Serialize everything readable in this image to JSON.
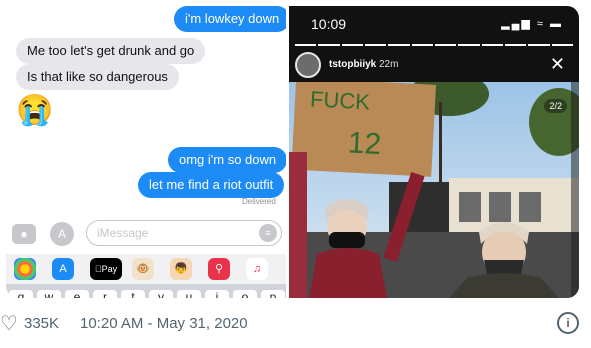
{
  "imessage": {
    "messages": [
      {
        "from": "out",
        "text": "i'm lowkey down"
      },
      {
        "from": "in",
        "text": "Me too let's get drunk and go"
      },
      {
        "from": "in",
        "text": "Is that like so dangerous"
      },
      {
        "from": "in-emoji",
        "text": "😭"
      },
      {
        "from": "out",
        "text": "omg i'm so down"
      },
      {
        "from": "out",
        "text": "let me find a riot outfit"
      }
    ],
    "delivered": "Delivered",
    "input_placeholder": "iMessage",
    "app_icons": [
      "photos-app-icon",
      "app-store-icon",
      "apple-pay-icon",
      "animoji-monkey-icon",
      "memoji-icon",
      "search-images-icon",
      "music-icon"
    ],
    "apple_pay_label": "Pay",
    "keyboard_visible": [
      "q",
      "w",
      "e",
      "r",
      "t",
      "y",
      "u",
      "i",
      "o",
      "p"
    ]
  },
  "story": {
    "time": "10:09",
    "username": "tstopbiiyk",
    "ago": "22m",
    "counter": "2/2",
    "sign_text_line1": "FUCK",
    "sign_text_line2": "12",
    "progress_total": 12,
    "progress_filled": 12
  },
  "footer": {
    "likes": "335K",
    "timestamp": "10:20 AM - May 31, 2020"
  },
  "colors": {
    "imessage_blue": "#1d8bf6",
    "incoming_gray": "#e6e6eb",
    "footer_text": "#536471"
  }
}
